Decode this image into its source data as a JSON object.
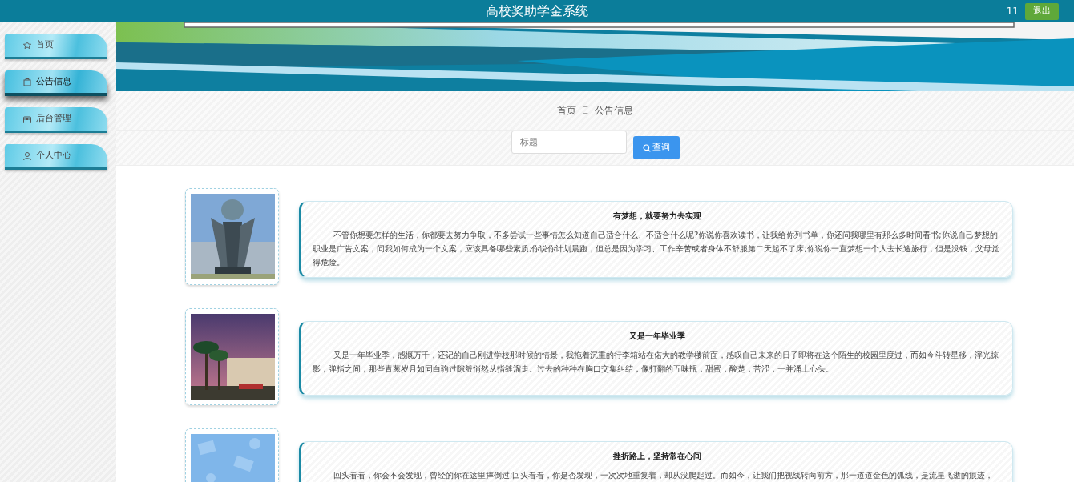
{
  "header": {
    "title": "高校奖助学金系统",
    "user": "11",
    "logout": "退出"
  },
  "sidebar": {
    "items": [
      {
        "label": "首页",
        "selected": false
      },
      {
        "label": "公告信息",
        "selected": true
      },
      {
        "label": "后台管理",
        "selected": false
      },
      {
        "label": "个人中心",
        "selected": false
      }
    ]
  },
  "breadcrumb": [
    "首页",
    "Ξ",
    "公告信息"
  ],
  "search": {
    "placeholder": "标题",
    "button": "查询"
  },
  "notices": [
    {
      "title": "有梦想，就要努力去实现",
      "body": "不管你想要怎样的生活，你都要去努力争取，不多尝试一些事情怎么知道自己适合什么、不适合什么呢?你说你喜欢读书，让我给你列书单，你还问我哪里有那么多时间看书;你说自己梦想的职业是广告文案，问我如何成为一个文案，应该具备哪些素质;你说你计划晨跑，但总是因为学习、工作辛苦或者身体不舒服第二天起不了床;你说你一直梦想一个人去长途旅行，但是没钱，父母觉得危险。"
    },
    {
      "title": "又是一年毕业季",
      "body": "又是一年毕业季，感慨万千，还记的自己刚进学校那时候的情景，我拖着沉重的行李箱站在偌大的教学楼前面，感叹自己未来的日子即将在这个陌生的校园里度过，而如今斗转星移，浮光掠影，弹指之间，那些青葱岁月如同白驹过隙般悄然从指缝溜走。过去的种种在胸口交集纠结，像打翻的五味瓶，甜蜜，酸楚，苦涩，一并涌上心头。"
    },
    {
      "title": "挫折路上，坚持常在心间",
      "body": "回头看看，你会不会发现，曾经的你在这里摔倒过;回头看看，你是否发现，一次次地重复着，却从没爬起过。而如今，让我们把视线转向前方，那一道道金色的弧线，是流星飞逝的痕迹，"
    }
  ]
}
